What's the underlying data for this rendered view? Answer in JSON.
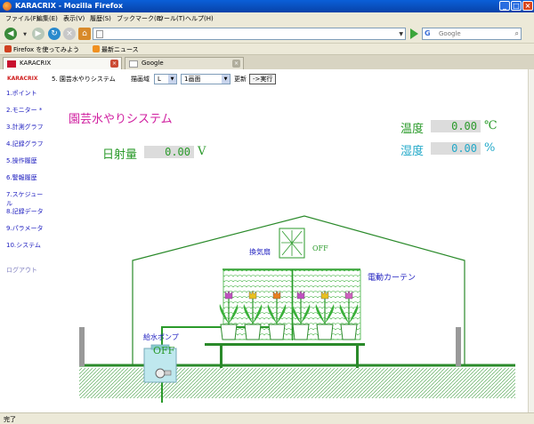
{
  "window": {
    "title": "KARACRIX - Mozilla Firefox"
  },
  "menu": [
    "ファイル(F)",
    "編集(E)",
    "表示(V)",
    "履歴(S)",
    "ブックマーク(B)",
    "ツール(T)",
    "ヘルプ(H)"
  ],
  "toolbar": {
    "url": "",
    "search_placeholder": "Google"
  },
  "bookmarks": [
    {
      "label": "Firefox を使ってみよう",
      "icon": "firefox-icon"
    },
    {
      "label": "最新ニュース",
      "icon": "rss-icon"
    }
  ],
  "tabs": [
    {
      "label": "KARACRIX",
      "active": true
    },
    {
      "label": "Google",
      "active": false
    }
  ],
  "sidebar": {
    "logo": "KARACRIX",
    "items": [
      "1.ポイント",
      "2.モニター *",
      "3.計測グラフ",
      "4.記録グラフ",
      "5.操作履歴",
      "6.警報履歴",
      "7.スケジュール",
      "8.記録データ",
      "9.パラメータ",
      "10.システム"
    ],
    "logout": "ログアウト"
  },
  "controls": {
    "section": "5. 園芸水やりシステム",
    "draw_label": "描画域",
    "draw_value": "L",
    "view_value": "1画面",
    "update_label": "更新",
    "exec_label": "->実行"
  },
  "monitor": {
    "title": "園芸水やりシステム",
    "solar": {
      "label": "日射量",
      "value": "0.00",
      "unit": "V"
    },
    "temperature": {
      "label": "温度",
      "value": "0.00",
      "unit": "℃"
    },
    "humidity": {
      "label": "湿度",
      "value": "0.00",
      "unit": "%"
    },
    "fan": {
      "label": "換気扇",
      "status": "OFF"
    },
    "curtain": {
      "label": "電動カーテン"
    },
    "pump": {
      "label": "給水ポンプ",
      "status": "OFF"
    }
  },
  "colors": {
    "green": "#2a9a2a",
    "teal": "#20a8c8",
    "magenta": "#d020a0",
    "blue": "#2020c0",
    "house_outline": "#2a8a2a"
  },
  "status": {
    "text": "完了"
  }
}
